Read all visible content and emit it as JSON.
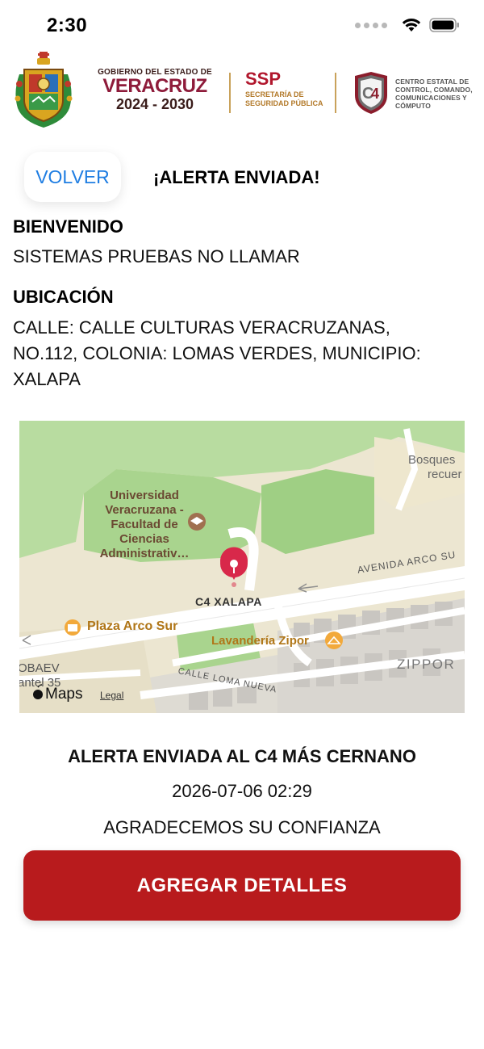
{
  "status_bar": {
    "time": "2:30"
  },
  "header": {
    "gov_small": "GOBIERNO DEL ESTADO DE",
    "gov_state": "VERACRUZ",
    "gov_years": "2024 - 2030",
    "ssp_acronym": "SSP",
    "ssp_line1": "SECRETARÍA DE",
    "ssp_line2": "SEGURIDAD PÚBLICA",
    "c4_line1": "CENTRO ESTATAL DE",
    "c4_line2": "CONTROL, COMANDO,",
    "c4_line3": "COMUNICACIONES Y",
    "c4_line4": "CÓMPUTO"
  },
  "nav": {
    "back_label": "VOLVER",
    "title": "¡ALERTA ENVIADA!"
  },
  "welcome": {
    "label": "BIENVENIDO",
    "name": "SISTEMAS PRUEBAS NO LLAMAR"
  },
  "location": {
    "label": "UBICACIÓN",
    "line1": "CALLE: CALLE CULTURAS VERACRUZANAS,",
    "line2": "NO.112, COLONIA: LOMAS VERDES, MUNICIPIO:",
    "line3": "XALAPA"
  },
  "map": {
    "pin_label": "C4 XALAPA",
    "poi_university_1": "Universidad",
    "poi_university_2": "Veracruzana -",
    "poi_university_3": "Facultad de",
    "poi_university_4": "Ciencias",
    "poi_university_5": "Administrativ…",
    "poi_plaza": "Plaza Arco Sur",
    "poi_lavanderia": "Lavandería Zipor",
    "street_avenida": "AVENIDA ARCO SU",
    "street_loma": "CALLE LOMA NUEVA",
    "area_zippor": "ZIPPOR",
    "area_bosques_1": "Bosques",
    "area_bosques_2": "recuer",
    "area_obaev_1": "OBAEV",
    "area_obaev_2": "antel 35",
    "maps_brand": "Maps",
    "legal": "Legal"
  },
  "confirmation": {
    "sent_to": "ALERTA ENVIADA AL C4 MÁS CERNANO",
    "timestamp": "2026-07-06 02:29",
    "thanks": "AGRADECEMOS SU CONFIANZA"
  },
  "actions": {
    "add_details_label": "AGREGAR DETALLES"
  },
  "colors": {
    "accent_blue": "#1e7de2",
    "button_red": "#b81b1d",
    "pin_red": "#d8284a"
  }
}
